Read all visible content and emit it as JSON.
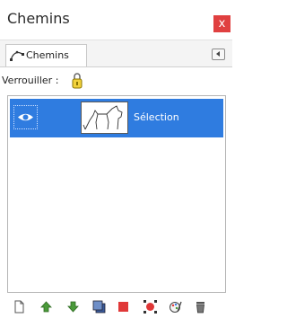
{
  "window": {
    "title": "Chemins",
    "close_label": "x"
  },
  "tabs": [
    {
      "label": "Chemins",
      "icon": "paths-icon"
    }
  ],
  "lock": {
    "label": "Verrouiller :",
    "icon": "lock-alpha-icon"
  },
  "paths": [
    {
      "name": "Sélection",
      "visible": true,
      "selected": true,
      "thumbnail": "cat-silhouette-path"
    }
  ],
  "toolbar": [
    {
      "name": "new-path-button",
      "icon": "new-document-icon"
    },
    {
      "name": "raise-path-button",
      "icon": "arrow-up-icon"
    },
    {
      "name": "lower-path-button",
      "icon": "arrow-down-icon"
    },
    {
      "name": "duplicate-path-button",
      "icon": "duplicate-icon"
    },
    {
      "name": "path-to-selection-button",
      "icon": "path-to-selection-icon"
    },
    {
      "name": "selection-to-path-button",
      "icon": "selection-to-path-icon"
    },
    {
      "name": "paint-along-path-button",
      "icon": "paint-path-icon"
    },
    {
      "name": "delete-path-button",
      "icon": "trash-icon"
    }
  ],
  "colors": {
    "selection_row": "#2f7ce0",
    "close": "#e04040",
    "arrows": "#4a9a3a"
  }
}
